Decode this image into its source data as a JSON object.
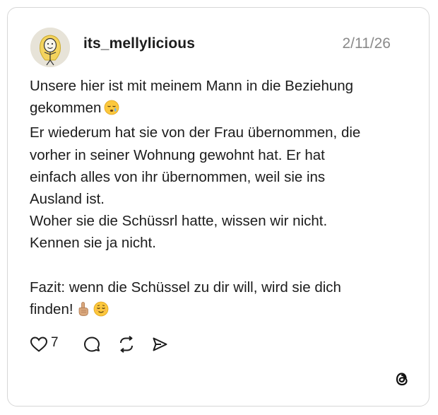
{
  "post": {
    "username": "its_mellylicious",
    "date": "2/11/26",
    "lines": [
      "Unsere hier ist mit meinem Mann in die Beziehung",
      "gekommen",
      "Er wiederum hat sie von der Frau übernommen, die",
      "vorher in seiner Wohnung gewohnt hat. Er hat",
      "einfach alles von ihr übernommen, weil sie ins",
      "Ausland ist.",
      "Woher sie die Schüssrl hatte, wissen wir nicht.",
      "Kennen sie ja nicht.",
      "",
      "Fazit: wenn die Schüssel zu dir will, wird sie dich",
      "finden!"
    ],
    "emojis": {
      "line2": "sleepy-face-emoji",
      "line11": [
        "index-pointing-up-emoji",
        "relieved-face-emoji"
      ]
    }
  },
  "actions": {
    "like_count": "7",
    "icons": [
      "heart-icon",
      "comment-icon",
      "repost-icon",
      "share-icon"
    ]
  },
  "branding": {
    "logo": "threads-logo-icon"
  },
  "colors": {
    "text": "#1c1c1c",
    "muted": "#8a8a8a",
    "border": "#d7d7d7"
  }
}
